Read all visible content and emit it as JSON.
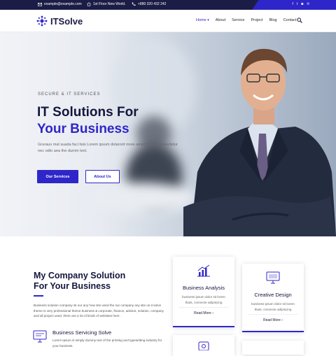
{
  "topbar": {
    "email": "example@example.com",
    "address": "1st Floor New World.",
    "phone": "+880 320 432 242"
  },
  "nav": {
    "logo_text": "ITSolve",
    "items": [
      "Home",
      "About",
      "Service",
      "Project",
      "Blog",
      "Contact"
    ],
    "home_caret": "▾"
  },
  "hero": {
    "eyebrow": "SECURE & IT SERVICES",
    "title_line1": "IT Solutions For",
    "title_line2": "Your Business",
    "description": "Gruraus mal suada faci lisis Lorem ipsum dolarorit more ametion the consectetur nec odio aea the dumm text.",
    "btn_primary": "Our Services",
    "btn_secondary": "About Us"
  },
  "company": {
    "heading_line1": "My Company Solution",
    "heading_line2": "For Your Business",
    "body": "Business solution company sit our any how site used the our company any site us it-solve theme is very professional theme business & corporate, finance, advisor, solution, company and all project used, there are a lot of kinds of websites here.",
    "service_title": "Business Servicing Solve",
    "service_text": "Lorem Ipsum is simply dummy text of the printing and typesetting industry for your business."
  },
  "cards": [
    {
      "title": "Business Analysis",
      "desc": "business ipsum dolor sit lorem thats, connecte adipiscing",
      "link": "Read More ›"
    },
    {
      "title": "Creative Design",
      "desc": "business ipsum dolor sit lorem thats, connecte adipiscing",
      "link": "Read More ›"
    }
  ],
  "colors": {
    "accent": "#2f26c9",
    "dark": "#1b1d46"
  }
}
